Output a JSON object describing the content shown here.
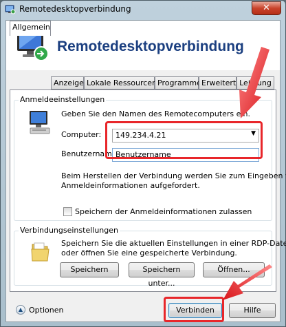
{
  "window": {
    "title": "Remotedesktopverbindung",
    "close_label": "✕"
  },
  "banner": {
    "title": "Remotedesktopverbindung"
  },
  "tabs": [
    {
      "label": "Allgemein"
    },
    {
      "label": "Anzeige"
    },
    {
      "label": "Lokale Ressourcen"
    },
    {
      "label": "Programme"
    },
    {
      "label": "Erweitert"
    },
    {
      "label": "Leistung"
    }
  ],
  "logon": {
    "legend": "Anmeldeeinstellungen",
    "description": "Geben Sie den Namen des Remotecomputers ein.",
    "computer_label": "Computer:",
    "computer_value": "149.234.4.21",
    "username_label": "Benutzername:",
    "username_value": "Benutzername",
    "info_line1": "Beim Herstellen der Verbindung werden Sie zum Eingeben von",
    "info_line2": "Anmeldeinformationen aufgefordert.",
    "save_checkbox_label": "Speichern der Anmeldeinformationen zulassen"
  },
  "connection": {
    "legend": "Verbindungseinstellungen",
    "description_line1": "Speichern Sie die aktuellen Einstellungen in einer RDP-Datei,",
    "description_line2": "oder öffnen Sie eine gespeicherte Verbindung.",
    "save_button": "Speichern",
    "save_as_button": "Speichern unter...",
    "open_button": "Öffnen..."
  },
  "footer": {
    "options_label": "Optionen",
    "connect_button": "Verbinden",
    "help_button": "Hilfe"
  },
  "colors": {
    "highlight": "#e8262a",
    "title_blue": "#1b3f80"
  }
}
